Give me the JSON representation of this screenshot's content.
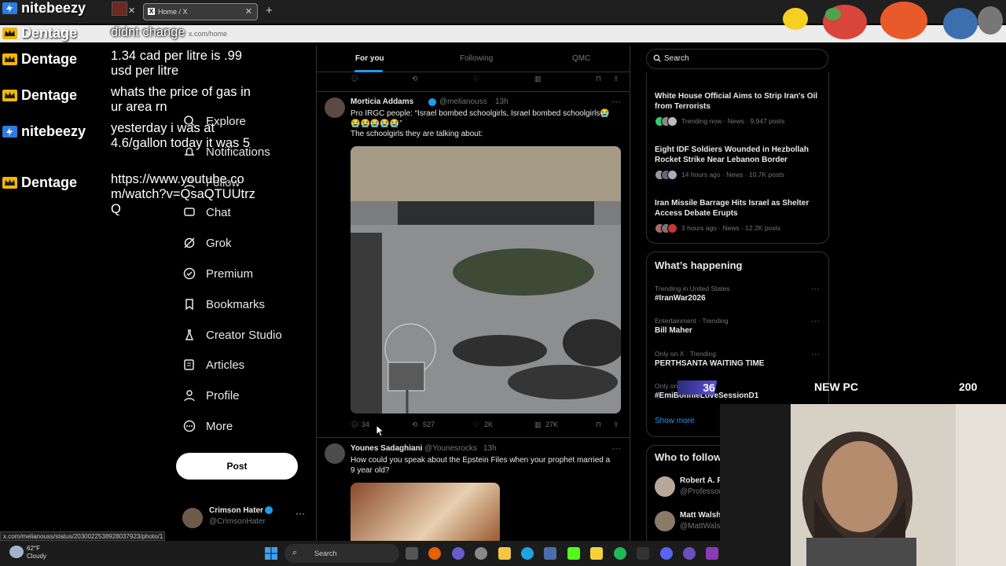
{
  "browser": {
    "tabs": [
      {
        "label": "Home / X"
      },
      {
        "label": "Home / X"
      }
    ],
    "url": "x.com/home",
    "new_tab_symbol": "+"
  },
  "chat": [
    {
      "user": "nitebeezy",
      "message": "",
      "icon": "bolt-icon",
      "color": "#2a7de1"
    },
    {
      "user": "Dentage",
      "message": "didnt change",
      "icon": "crown-icon",
      "color": "#f2b705"
    },
    {
      "user": "Dentage",
      "message": "1.34 cad per litre is .99 usd per litre",
      "icon": "crown-icon",
      "color": "#f2b705"
    },
    {
      "user": "Dentage",
      "message": "whats the price of gas in ur area rn",
      "icon": "crown-icon",
      "color": "#f2b705"
    },
    {
      "user": "nitebeezy",
      "message": "yesterday i was at 4.6/gallon today it was 5",
      "icon": "bolt-icon",
      "color": "#2a7de1"
    },
    {
      "user": "Dentage",
      "message": "https://www.youtube.com/watch?v=QsaQTUUtrzQ",
      "icon": "crown-icon",
      "color": "#f2b705"
    }
  ],
  "nav": {
    "items": [
      {
        "label": "Explore",
        "icon": "search-icon"
      },
      {
        "label": "Notifications",
        "icon": "bell-icon"
      },
      {
        "label": "Follow",
        "icon": "follow-icon"
      },
      {
        "label": "Chat",
        "icon": "chat-icon"
      },
      {
        "label": "Grok",
        "icon": "grok-icon"
      },
      {
        "label": "Premium",
        "icon": "premium-icon"
      },
      {
        "label": "Bookmarks",
        "icon": "bookmark-icon"
      },
      {
        "label": "Creator Studio",
        "icon": "flask-icon"
      },
      {
        "label": "Articles",
        "icon": "article-icon"
      },
      {
        "label": "Profile",
        "icon": "person-icon"
      },
      {
        "label": "More",
        "icon": "more-circle-icon"
      }
    ],
    "post_label": "Post",
    "account": {
      "name": "Crimson Hater",
      "handle": "@CrimsonHater"
    }
  },
  "timeline": {
    "tabs": [
      "For you",
      "Following",
      "QMC"
    ],
    "tweets": [
      {
        "name": "Morticia Addams",
        "handle": "@melianouss",
        "time": "13h",
        "text_line1": "Pro IRGC people: “Israel bombed schoolgirls, Israel bombed schoolgirls😭",
        "text_line2": "😭😭😭😭😭”",
        "text_line3": "The schoolgirls they are talking about:",
        "stats": {
          "replies": "34",
          "reposts": "527",
          "likes": "2K",
          "views": "27K"
        }
      },
      {
        "name": "Younes Sadaghiani",
        "handle": "@Younesrocks",
        "time": "13h",
        "text_line1": "How could you speak about the Epstein Files when your prophet married a",
        "text_line2": "9 year old?"
      }
    ]
  },
  "right": {
    "search_placeholder": "Search",
    "news": [
      {
        "title": "White House Official Aims to Strip Iran's Oil from Terrorists",
        "meta": "Trending now · News · 9,947 posts"
      },
      {
        "title": "Eight IDF Soldiers Wounded in Hezbollah Rocket Strike Near Lebanon Border",
        "meta": "14 hours ago · News · 10.7K posts"
      },
      {
        "title": "Iran Missile Barrage Hits Israel as Shelter Access Debate Erupts",
        "meta": "3 hours ago · News · 12.2K posts"
      }
    ],
    "happening_title": "What’s happening",
    "trends": [
      {
        "meta": "Trending in United States",
        "name": "#IranWar2026"
      },
      {
        "meta": "Entertainment · Trending",
        "name": "Bill Maher"
      },
      {
        "meta": "Only on X · Trending",
        "name": "PERTHSANTA WAITING TIME"
      },
      {
        "meta": "Only on X",
        "name": "#EmiBonnieLoveSessionD1"
      }
    ],
    "show_more": "Show more",
    "who_title": "Who to follow",
    "who": [
      {
        "name": "Robert A. F",
        "handle": "@Professor"
      },
      {
        "name": "Matt Walsh",
        "handle": "@MattWals"
      }
    ]
  },
  "overlay": {
    "stat_left": "36",
    "stat_mid": "NEW PC",
    "stat_right": "200"
  },
  "status_url": "x.com/melianouss/status/2030022538928037923/photo/1",
  "taskbar": {
    "temp": "62°F",
    "condition": "Cloudy",
    "search": "Search"
  }
}
